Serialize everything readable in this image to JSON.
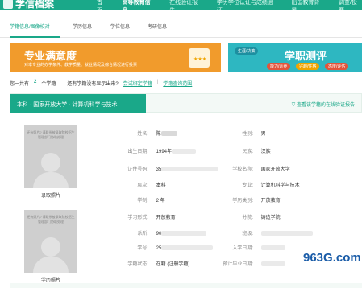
{
  "header": {
    "brand": "学信档案",
    "nav": [
      "首页",
      "高等教育信息",
      "在线验证报告",
      "学历学位认证与成绩验证",
      "出国教育背景",
      "调查/投票"
    ]
  },
  "subnav": {
    "items": [
      "学籍信息/图像校对",
      "学历信息",
      "学位信息",
      "考研信息"
    ]
  },
  "banner_left": {
    "title": "专业满意度",
    "subtitle": "对本专业的办学条件、教学质量、就业情况及综合情况进行投票",
    "stars": "★★★"
  },
  "banner_right": {
    "title": "学职测评",
    "tags": [
      "生涯/决策",
      "能力/素养",
      "兴趣/性格",
      "态度/评估"
    ]
  },
  "countline": {
    "prefix": "您一共有",
    "count": "2",
    "suffix": "个学籍",
    "question": "还有学籍没有显示出来?",
    "link1": "尝试绑定学籍",
    "sep": "|",
    "link2": "学籍查询范围"
  },
  "record": {
    "title": "本科 · 国家开放大学 · 计算机科学与技术",
    "verify": "查看该学籍的在线验证报告",
    "photo1_note": "还有照片? 请联系被录取院校招生管理部门协助处理",
    "photo1_caption": "录取照片",
    "photo2_note": "还有照片? 请联系被录取院校招生管理部门协助处理",
    "photo2_caption": "学历照片",
    "left_fields": [
      {
        "label": "姓名:",
        "value": "陈"
      },
      {
        "label": "出生日期:",
        "value": "1994年"
      },
      {
        "label": "证件号码:",
        "value": "35"
      },
      {
        "label": "层次:",
        "value": "本科"
      },
      {
        "label": "学制:",
        "value": "2 年"
      },
      {
        "label": "学习形式:",
        "value": "开放教育"
      },
      {
        "label": "系所:",
        "value": "90"
      },
      {
        "label": "学号:",
        "value": "25"
      },
      {
        "label": "学籍状态:",
        "value": "在籍 (注册学籍)"
      }
    ],
    "right_fields": [
      {
        "label": "性别:",
        "value": "男"
      },
      {
        "label": "民族:",
        "value": "汉族"
      },
      {
        "label": "学校名称:",
        "value": "国家开放大学"
      },
      {
        "label": "专业:",
        "value": "计算机科学与技术"
      },
      {
        "label": "学历类别:",
        "value": "开放教育"
      },
      {
        "label": "分院:",
        "value": "铸造学院"
      },
      {
        "label": "班级:",
        "value": ""
      },
      {
        "label": "入学日期:",
        "value": ""
      },
      {
        "label": "预计毕业日期:",
        "value": ""
      }
    ]
  },
  "watermark": "963G.com",
  "colors": {
    "accent": "#1aa889",
    "banner_orange": "#f19b2c",
    "banner_teal": "#2eb7c1",
    "watermark_blue": "#1a5ca8"
  }
}
